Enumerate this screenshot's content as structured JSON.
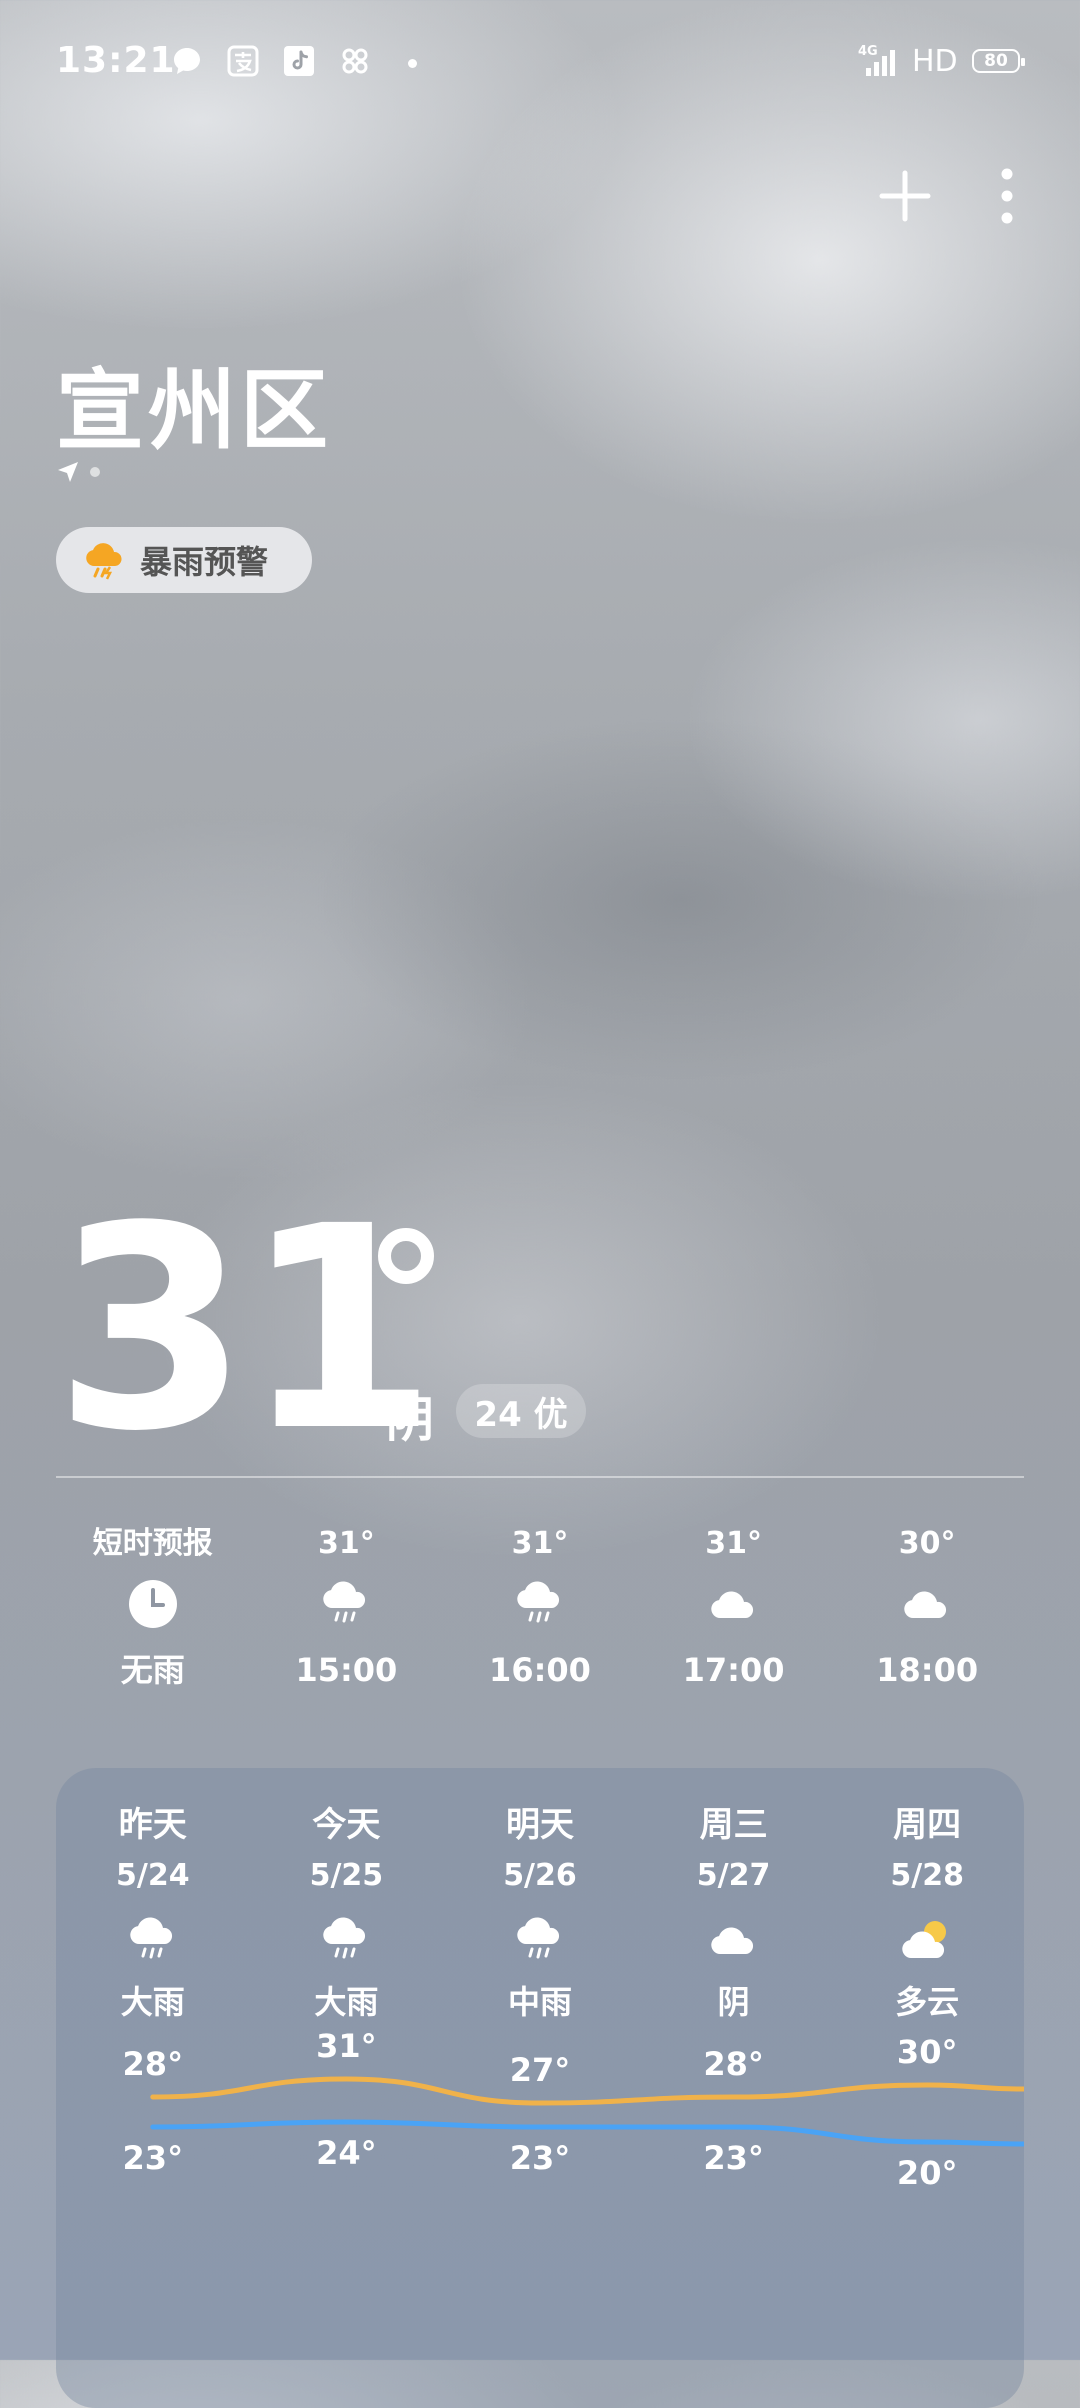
{
  "status_bar": {
    "time": "13:21",
    "network_type": "4G",
    "hd_label": "HD",
    "battery": "80"
  },
  "header": {
    "add_icon": "plus-icon",
    "more_icon": "more-vertical-icon"
  },
  "location": {
    "city": "宣州区",
    "alert": "暴雨预警",
    "alert_color": "#f5a623"
  },
  "current": {
    "temperature": "31",
    "condition": "阴",
    "aqi": "24 优"
  },
  "hourly": [
    {
      "top": "短时预报",
      "icon": "clock-icon",
      "bottom": "无雨"
    },
    {
      "top": "31°",
      "icon": "rain-icon",
      "bottom": "15:00"
    },
    {
      "top": "31°",
      "icon": "rain-icon",
      "bottom": "16:00"
    },
    {
      "top": "31°",
      "icon": "cloud-icon",
      "bottom": "17:00"
    },
    {
      "top": "30°",
      "icon": "cloud-icon",
      "bottom": "18:00"
    }
  ],
  "daily": [
    {
      "name": "昨天",
      "date": "5/24",
      "icon": "rain-icon",
      "condition": "大雨",
      "high": "28°",
      "low": "23°",
      "high_val": 28,
      "low_val": 23
    },
    {
      "name": "今天",
      "date": "5/25",
      "icon": "rain-icon",
      "condition": "大雨",
      "high": "31°",
      "low": "24°",
      "high_val": 31,
      "low_val": 24
    },
    {
      "name": "明天",
      "date": "5/26",
      "icon": "rain-icon",
      "condition": "中雨",
      "high": "27°",
      "low": "23°",
      "high_val": 27,
      "low_val": 23
    },
    {
      "name": "周三",
      "date": "5/27",
      "icon": "cloud-icon",
      "condition": "阴",
      "high": "28°",
      "low": "23°",
      "high_val": 28,
      "low_val": 23
    },
    {
      "name": "周四",
      "date": "5/28",
      "icon": "partly-cloudy-icon",
      "condition": "多云",
      "high": "30°",
      "low": "20°",
      "high_val": 30,
      "low_val": 20
    }
  ],
  "colors": {
    "high_line": "#f0b24a",
    "low_line": "#4aa3f5",
    "sun": "#f7c948"
  }
}
